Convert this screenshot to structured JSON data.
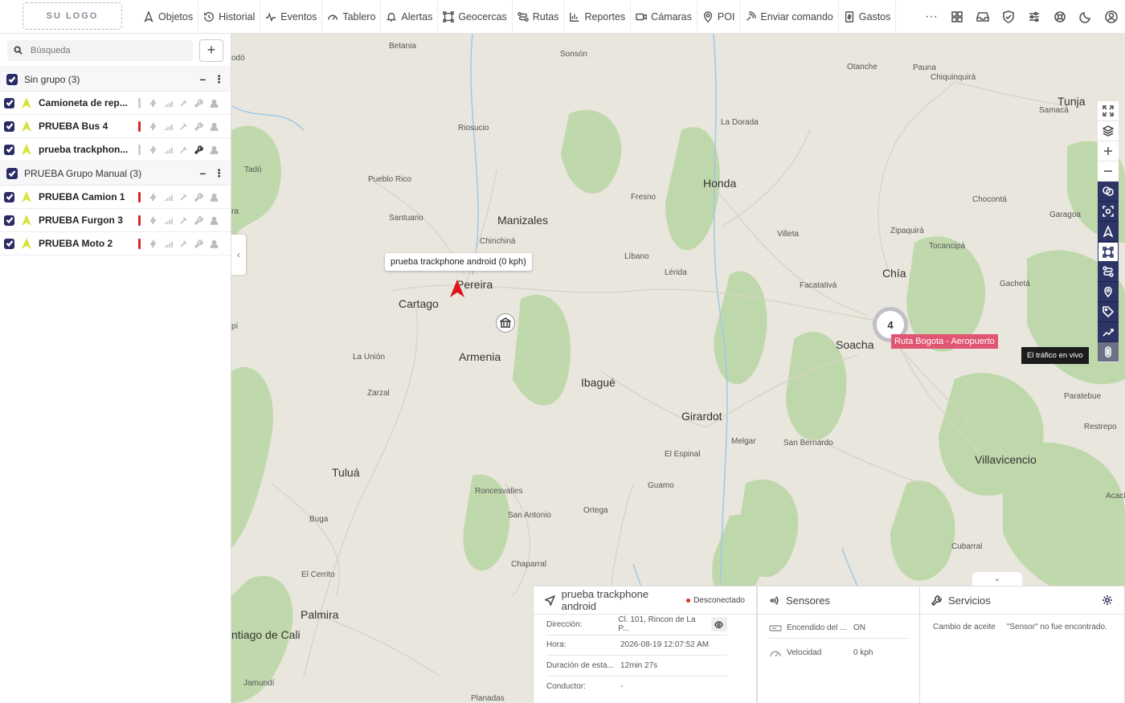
{
  "topbar": {
    "logo_text": "SU LOGO",
    "nav": [
      {
        "label": "Objetos",
        "icon": "navigation-icon"
      },
      {
        "label": "Historial",
        "icon": "history-icon"
      },
      {
        "label": "Eventos",
        "icon": "pulse-icon"
      },
      {
        "label": "Tablero",
        "icon": "gauge-icon"
      },
      {
        "label": "Alertas",
        "icon": "bell-icon"
      },
      {
        "label": "Geocercas",
        "icon": "geofence-icon"
      },
      {
        "label": "Rutas",
        "icon": "route-icon"
      },
      {
        "label": "Reportes",
        "icon": "bar-chart-icon"
      },
      {
        "label": "Cámaras",
        "icon": "video-camera-icon"
      },
      {
        "label": "POI",
        "icon": "map-pin-icon"
      },
      {
        "label": "Enviar comando",
        "icon": "signal-icon"
      },
      {
        "label": "Gastos",
        "icon": "receipt-icon"
      }
    ],
    "more_label": "···"
  },
  "sidebar": {
    "search_placeholder": "Búsqueda",
    "add_label": "+",
    "groups": [
      {
        "title": "Sin grupo (3)",
        "objects": [
          {
            "name": "Camioneta de rep...",
            "status_color": "#cfcfcf",
            "wrench_dark": false
          },
          {
            "name": "PRUEBA Bus 4",
            "status_color": "#d9262b",
            "wrench_dark": false
          },
          {
            "name": "prueba trackphon...",
            "status_color": "#cfcfcf",
            "wrench_dark": true
          }
        ]
      },
      {
        "title": "PRUEBA Grupo Manual (3)",
        "objects": [
          {
            "name": "PRUEBA Camion 1",
            "status_color": "#d9262b",
            "wrench_dark": false
          },
          {
            "name": "PRUEBA Furgon 3",
            "status_color": "#d9262b",
            "wrench_dark": false
          },
          {
            "name": "PRUEBA Moto 2",
            "status_color": "#d9262b",
            "wrench_dark": false
          }
        ]
      }
    ]
  },
  "map": {
    "tooltip": "prueba trackphone android (0 kph)",
    "cluster_count": "4",
    "route_label": "Ruta Bogota - Aeropuerto",
    "live_traffic_tip": "El tráfico en vivo",
    "cities_big": [
      "Manizales",
      "Pereira",
      "Cartago",
      "Armenia",
      "Ibagué",
      "Honda",
      "Girardot",
      "Tuluá",
      "Palmira",
      "Chía",
      "Soacha",
      "Villavicencio",
      "Tunja",
      "ntiago de Cali"
    ],
    "cities_small": [
      "odó",
      "Betania",
      "Sonsón",
      "Otanche",
      "Pauna",
      "Chiquinquirá",
      "Samacá",
      "La Dorada",
      "Riosucio",
      "Tadó",
      "Pueblo Rico",
      "Fresno",
      "Chinchiná",
      "Santuario",
      "Líbano",
      "Lérida",
      "Villeta",
      "Zipaquirá",
      "Tocancipá",
      "Chocontá",
      "Garagoa",
      "Facatativá",
      "Gachetá",
      "La Unión",
      "Zarzal",
      "Melgar",
      "San Bernardo",
      "El Espinal",
      "Paratebue",
      "Restrepo",
      "Roncesvalles",
      "Guamo",
      "Acacías",
      "San Antonio",
      "Ortega",
      "Buga",
      "Chaparral",
      "Cubarral",
      "El Cerrito",
      "Jamundí",
      "Planadas",
      "pí",
      "ra"
    ]
  },
  "object_panel": {
    "title": "prueba trackphone android",
    "status": "Desconectado",
    "rows": [
      {
        "k": "Dirección:",
        "v": "Cl. 101, Rincon de La P..."
      },
      {
        "k": "Hora:",
        "v": "2026-08-19 12:07:52 AM"
      },
      {
        "k": "Duración de esta...",
        "v": "12min 27s"
      },
      {
        "k": "Conductor:",
        "v": "-"
      }
    ]
  },
  "sensors_panel": {
    "title": "Sensores",
    "rows": [
      {
        "name": "Encendido del ...",
        "value": "ON"
      },
      {
        "name": "Velocidad",
        "value": "0 kph"
      }
    ]
  },
  "services_panel": {
    "title": "Servicios",
    "name": "Cambio de aceite",
    "value": "\"Sensor\" no fue encontrado."
  }
}
